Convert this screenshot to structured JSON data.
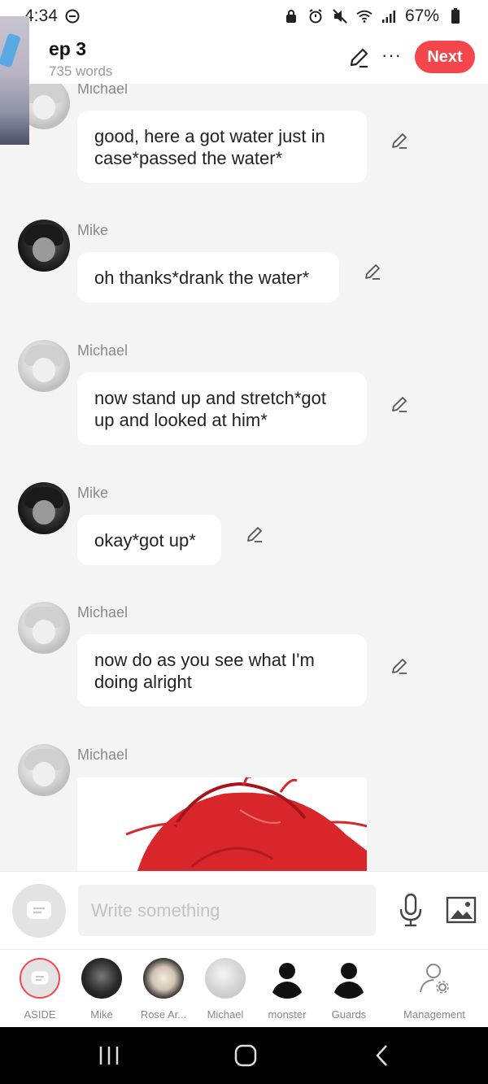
{
  "status": {
    "time": "4:34",
    "battery": "67%"
  },
  "header": {
    "title": "ep 3",
    "subtitle": "735 words",
    "next_label": "Next",
    "more_label": "···"
  },
  "messages": [
    {
      "speaker": "Michael",
      "text": "good, here a got water just in case*passed the water*"
    },
    {
      "speaker": "Mike",
      "text": "oh thanks*drank the water*"
    },
    {
      "speaker": "Michael",
      "text": "now stand up and stretch*got up and looked at him*"
    },
    {
      "speaker": "Mike",
      "text": "okay*got up*"
    },
    {
      "speaker": "Michael",
      "text": "now do as you see what I'm doing alright"
    },
    {
      "speaker": "Michael",
      "text": ""
    }
  ],
  "input": {
    "placeholder": "Write something"
  },
  "characters": [
    {
      "label": "ASIDE"
    },
    {
      "label": "Mike"
    },
    {
      "label": "Rose Ar..."
    },
    {
      "label": "Michael"
    },
    {
      "label": "monster"
    },
    {
      "label": "Guards"
    },
    {
      "label": "Management"
    }
  ],
  "colors": {
    "accent": "#f5464b",
    "background": "#f4f4f4",
    "bubble": "#ffffff"
  },
  "icons": {
    "back": "back-icon",
    "edit": "pencil-icon",
    "more": "more-icon",
    "aside": "chat-bubble-icon",
    "mic": "microphone-icon",
    "image": "image-icon",
    "management": "user-settings-icon"
  }
}
